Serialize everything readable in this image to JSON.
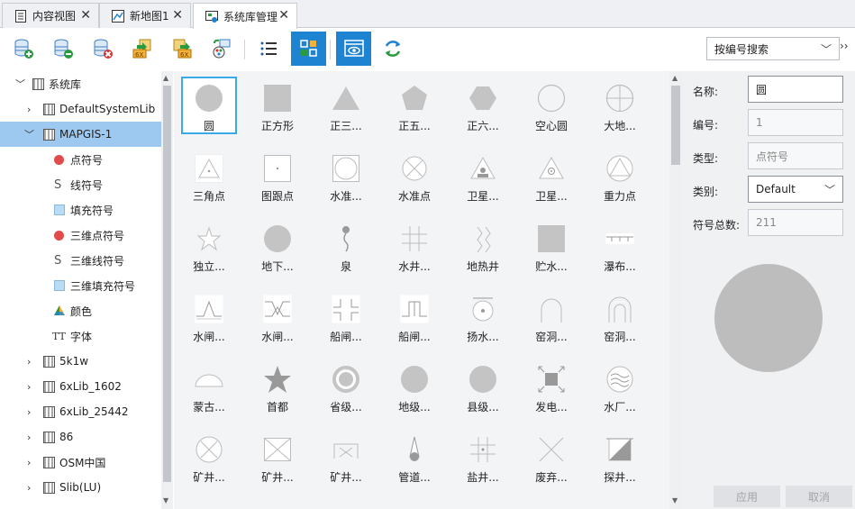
{
  "tabs": [
    {
      "label": "内容视图",
      "icon": "document-icon",
      "active": false
    },
    {
      "label": "新地图1",
      "icon": "map-icon",
      "active": false
    },
    {
      "label": "系统库管理",
      "icon": "library-manage-icon",
      "active": true
    }
  ],
  "toolbar": {
    "search_mode": "按编号搜索",
    "overflow": "››"
  },
  "tree": {
    "root": "系统库",
    "items": [
      {
        "label": "DefaultSystemLib",
        "level": 1,
        "expanded": false
      },
      {
        "label": "MAPGIS-1",
        "level": 1,
        "expanded": true,
        "selected": true
      },
      {
        "label": "点符号",
        "level": 2,
        "icon": "red-dot-icon"
      },
      {
        "label": "线符号",
        "level": 2,
        "icon": "line-symbol-icon"
      },
      {
        "label": "填充符号",
        "level": 2,
        "icon": "fill-symbol-icon"
      },
      {
        "label": "三维点符号",
        "level": 2,
        "icon": "red-dot-icon"
      },
      {
        "label": "三维线符号",
        "level": 2,
        "icon": "line-symbol-icon"
      },
      {
        "label": "三维填充符号",
        "level": 2,
        "icon": "fill-symbol-icon"
      },
      {
        "label": "颜色",
        "level": 2,
        "icon": "color-icon"
      },
      {
        "label": "字体",
        "level": 2,
        "icon": "font-icon",
        "glyph": "TT"
      },
      {
        "label": "5k1w",
        "level": 1,
        "expanded": false
      },
      {
        "label": "6xLib_1602",
        "level": 1,
        "expanded": false
      },
      {
        "label": "6xLib_25442",
        "level": 1,
        "expanded": false
      },
      {
        "label": "86",
        "level": 1,
        "expanded": false
      },
      {
        "label": "OSM中国",
        "level": 1,
        "expanded": false
      },
      {
        "label": "Slib(LU)",
        "level": 1,
        "expanded": false
      }
    ]
  },
  "symbols": [
    [
      "圆",
      "正方形",
      "正三...",
      "正五...",
      "正六...",
      "空心圆",
      "大地..."
    ],
    [
      "三角点",
      "图跟点",
      "水准...",
      "水准点",
      "卫星...",
      "卫星...",
      "重力点"
    ],
    [
      "独立...",
      "地下...",
      "泉",
      "水井...",
      "地热井",
      "贮水...",
      "瀑布..."
    ],
    [
      "水闸...",
      "水闸...",
      "船闸...",
      "船闸...",
      "扬水...",
      "窑洞...",
      "窑洞..."
    ],
    [
      "蒙古...",
      "首都",
      "省级...",
      "地级...",
      "县级...",
      "发电...",
      "水厂..."
    ],
    [
      "矿井...",
      "矿井...",
      "矿井...",
      "管道...",
      "盐井...",
      "废弃...",
      "探井..."
    ]
  ],
  "properties": {
    "name_label": "名称:",
    "name_value": "圆",
    "id_label": "编号:",
    "id_value": "1",
    "type_label": "类型:",
    "type_value": "点符号",
    "category_label": "类别:",
    "category_value": "Default",
    "total_label": "符号总数:",
    "total_value": "211",
    "apply_label": "应用",
    "cancel_label": "取消"
  }
}
